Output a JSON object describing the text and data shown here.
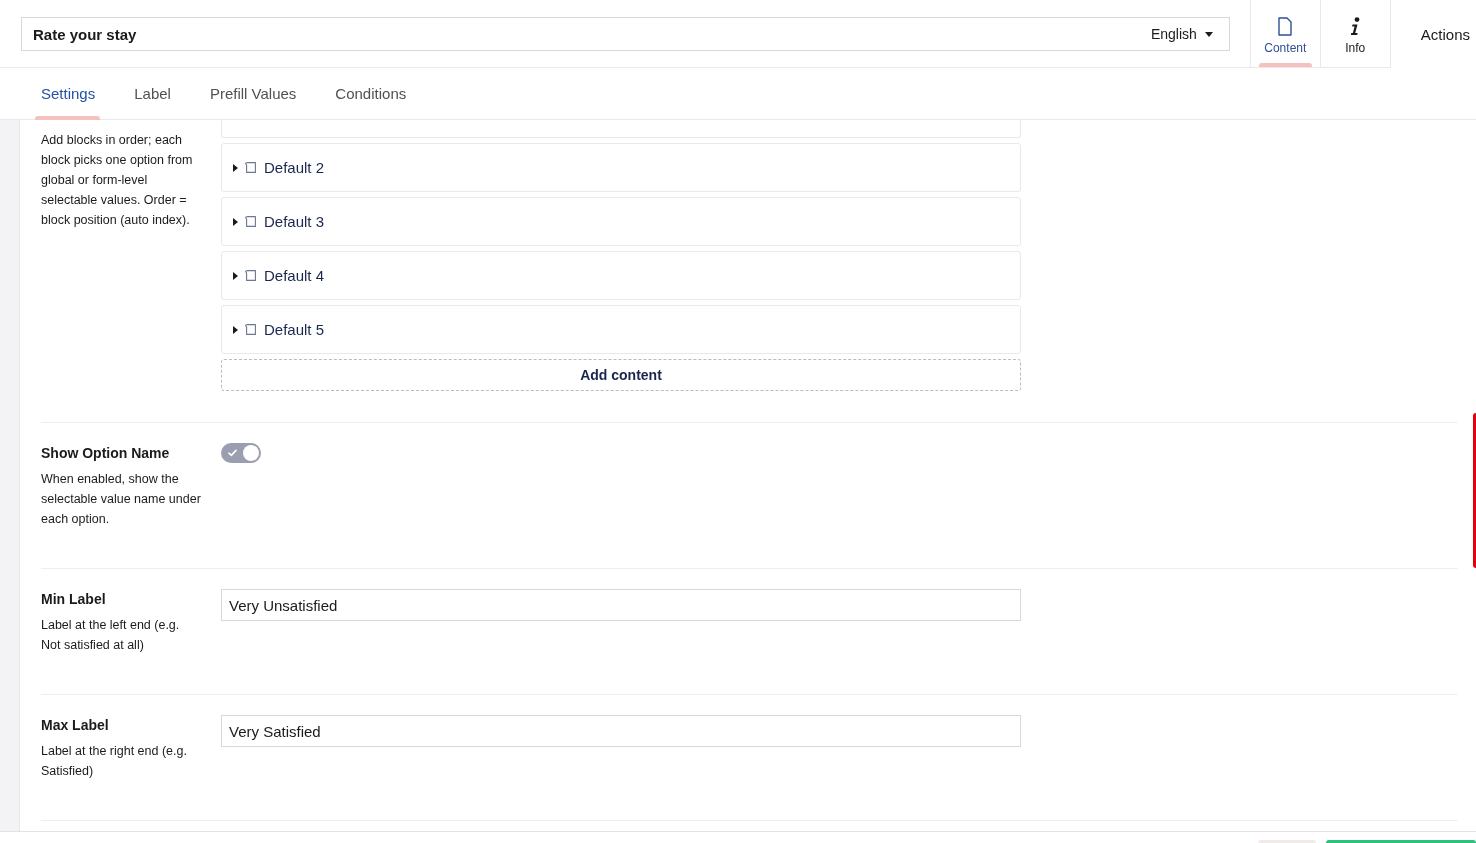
{
  "header": {
    "name_field": {
      "value": "Rate your stay"
    },
    "language": "English",
    "apps": [
      {
        "kind": "document",
        "label": "Content",
        "selected": true
      },
      {
        "kind": "info",
        "label": "Info",
        "selected": false
      }
    ],
    "actions": "Actions"
  },
  "tabs": [
    {
      "label": "Settings",
      "selected": true
    },
    {
      "label": "Label",
      "selected": false
    },
    {
      "label": "Prefill Values",
      "selected": false
    },
    {
      "label": "Conditions",
      "selected": false
    }
  ],
  "properties": [
    {
      "kind": "blocks",
      "description": "Add blocks in order; each block picks one option from global or form-level selectable values. Order = block position (auto index).",
      "blocks": [
        {
          "label": "Default 2",
          "expanded": false
        },
        {
          "label": "Default 3",
          "expanded": false
        },
        {
          "label": "Default 4",
          "expanded": false
        },
        {
          "label": "Default 5",
          "expanded": false
        }
      ],
      "add_button": "Add content"
    },
    {
      "kind": "toggle",
      "label": "Show Option Name",
      "description": "When enabled, show the selectable value name under each option.",
      "on": true
    },
    {
      "kind": "text",
      "label": "Min Label",
      "description": "Label at the left end (e.g. Not satisfied at all)",
      "value": "Very Unsatisfied"
    },
    {
      "kind": "text",
      "label": "Max Label",
      "description": "Label at the right end (e.g. Satisfied)",
      "value": "Very Satisfied"
    }
  ]
}
